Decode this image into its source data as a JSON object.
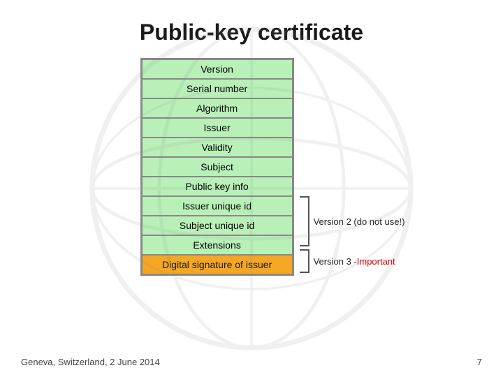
{
  "title": "Public-key certificate",
  "cert": {
    "rows": [
      {
        "label": "Version",
        "style": "green"
      },
      {
        "label": "Serial number",
        "style": "green"
      },
      {
        "label": "Algorithm",
        "style": "green"
      },
      {
        "label": "Issuer",
        "style": "green"
      },
      {
        "label": "Validity",
        "style": "green"
      },
      {
        "label": "Subject",
        "style": "green"
      },
      {
        "label": "Public key info",
        "style": "green"
      },
      {
        "label": "Issuer unique id",
        "style": "green"
      },
      {
        "label": "Subject unique id",
        "style": "green"
      },
      {
        "label": "Extensions",
        "style": "green"
      },
      {
        "label": "Digital signature of issuer",
        "style": "orange"
      }
    ]
  },
  "annotations": {
    "version2": "Version 2 (do not use!)",
    "version3_prefix": "Version 3 - ",
    "version3_important": "Important"
  },
  "footer": {
    "location": "Geneva, Switzerland, 2 June 2014",
    "page": "7"
  }
}
